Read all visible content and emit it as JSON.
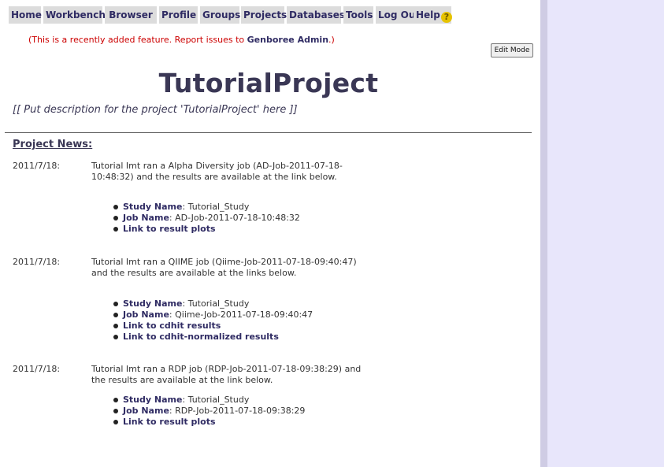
{
  "nav": {
    "items": [
      "Home",
      "Workbench",
      "Browser",
      "Profile",
      "Groups",
      "Projects",
      "Databases",
      "Tools",
      "Log Out",
      "Help"
    ]
  },
  "notice": {
    "prefix": "(This is a recently added feature. Report issues to ",
    "admin": "Genboree Admin",
    "suffix": ".)"
  },
  "edit_mode_label": "Edit Mode",
  "project": {
    "title": "TutorialProject",
    "description": "[[ Put description for the project 'TutorialProject' here ]]"
  },
  "news": {
    "heading": "Project News:",
    "study_label": "Study Name",
    "job_label": "Job Name",
    "items": [
      {
        "date": "2011/7/18:",
        "text": "Tutorial Imt ran a Alpha Diversity job (AD-Job-2011-07-18-10:48:32) and the results are available at the link below.",
        "study": "Tutorial_Study",
        "job": "AD-Job-2011-07-18-10:48:32",
        "links": [
          "Link to result plots"
        ]
      },
      {
        "date": "2011/7/18:",
        "text": "Tutorial Imt ran a QIIME job (Qiime-Job-2011-07-18-09:40:47) and the results are available at the links below.",
        "study": "Tutorial_Study",
        "job": "Qiime-Job-2011-07-18-09:40:47",
        "links": [
          "Link to cdhit results",
          "Link to cdhit-normalized results"
        ]
      },
      {
        "date": "2011/7/18:",
        "text": "Tutorial Imt ran a RDP job (RDP-Job-2011-07-18-09:38:29) and the results are available at the link below.",
        "study": "Tutorial_Study",
        "job": "RDP-Job-2011-07-18-09:38:29",
        "links": [
          "Link to result plots"
        ]
      }
    ]
  }
}
